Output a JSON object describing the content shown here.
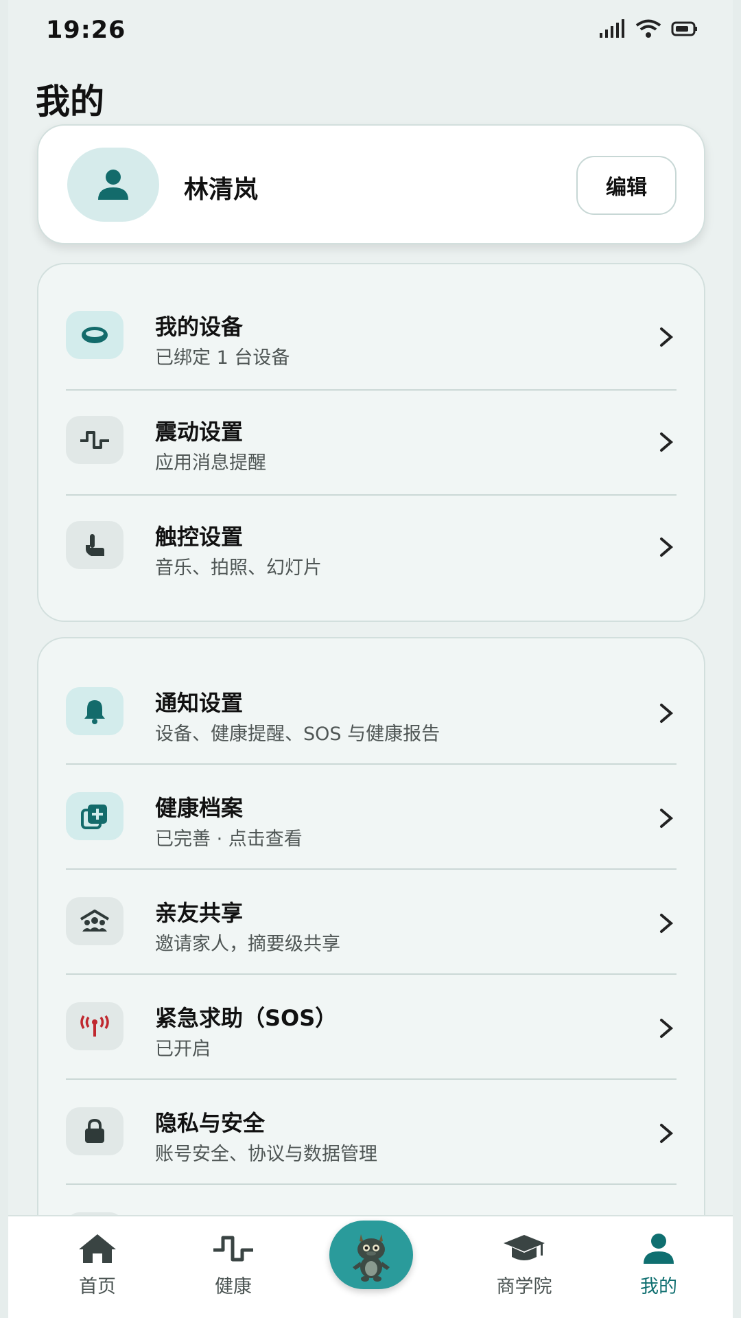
{
  "status": {
    "time": "19:26"
  },
  "page": {
    "title": "我的"
  },
  "profile": {
    "name": "林清岚",
    "edit_label": "编辑"
  },
  "device_menu": [
    {
      "title": "我的设备",
      "subtitle": "已绑定 1 台设备",
      "icon": "ring-icon"
    },
    {
      "title": "震动设置",
      "subtitle": "应用消息提醒",
      "icon": "pulse-icon"
    },
    {
      "title": "触控设置",
      "subtitle": "音乐、拍照、幻灯片",
      "icon": "touch-hand-icon"
    }
  ],
  "settings_menu": [
    {
      "title": "通知设置",
      "subtitle": "设备、健康提醒、SOS 与健康报告",
      "icon": "bell-icon"
    },
    {
      "title": "健康档案",
      "subtitle": "已完善 · 点击查看",
      "icon": "medical-record-icon"
    },
    {
      "title": "亲友共享",
      "subtitle": "邀请家人，摘要级共享",
      "icon": "family-home-icon"
    },
    {
      "title": "紧急求助（SOS）",
      "subtitle": "已开启",
      "icon": "sos-antenna-icon"
    },
    {
      "title": "隐私与安全",
      "subtitle": "账号安全、协议与数据管理",
      "icon": "lock-icon"
    }
  ],
  "tabbar": {
    "items": [
      {
        "label": "首页",
        "icon": "home-icon"
      },
      {
        "label": "健康",
        "icon": "pulse-icon"
      },
      {
        "label": "",
        "icon": "dragon-mascot-icon"
      },
      {
        "label": "商学院",
        "icon": "graduation-cap-icon"
      },
      {
        "label": "我的",
        "icon": "person-icon"
      }
    ],
    "active_index": 4
  },
  "colors": {
    "accent": "#0f6f70",
    "icon_teal": "#136b6b",
    "icon_dark": "#2f3a39",
    "sos_red": "#c0282f",
    "background": "#ebf1f0"
  }
}
